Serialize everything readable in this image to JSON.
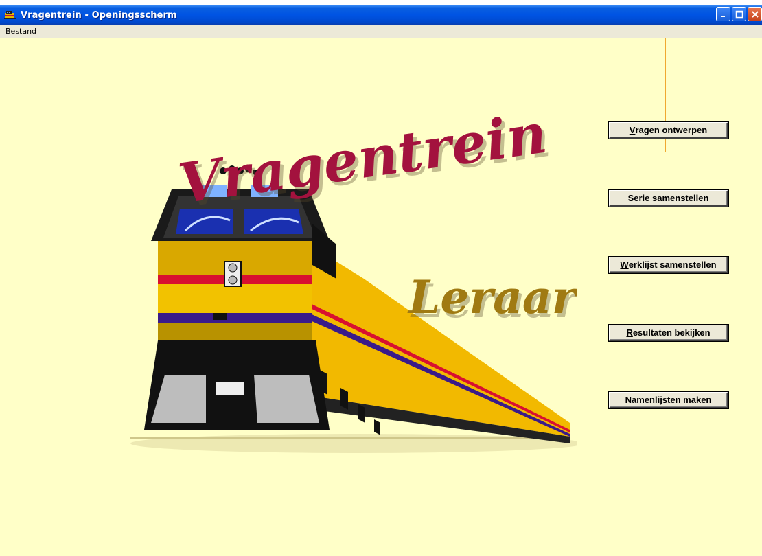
{
  "window": {
    "title": "Vragentrein - Openingsscherm",
    "controls": [
      "minimize-icon",
      "maximize-icon",
      "close-icon"
    ]
  },
  "menu": {
    "items": [
      {
        "label": "Bestand"
      }
    ]
  },
  "logo": {
    "title_word": "Vragentrein",
    "subtitle_word": "Leraar",
    "title_color": "#a3123e",
    "subtitle_color": "#a07a12"
  },
  "buttons": [
    {
      "accel": "V",
      "rest": "ragen ontwerpen"
    },
    {
      "accel": "S",
      "rest": "erie samenstellen"
    },
    {
      "accel": "W",
      "rest": "erklijst samenstellen"
    },
    {
      "accel": "R",
      "rest": "esultaten bekijken"
    },
    {
      "accel": "N",
      "rest": "amenlijsten maken"
    }
  ],
  "colors": {
    "background": "#ffffc8",
    "titlebar": "#0054e3"
  }
}
